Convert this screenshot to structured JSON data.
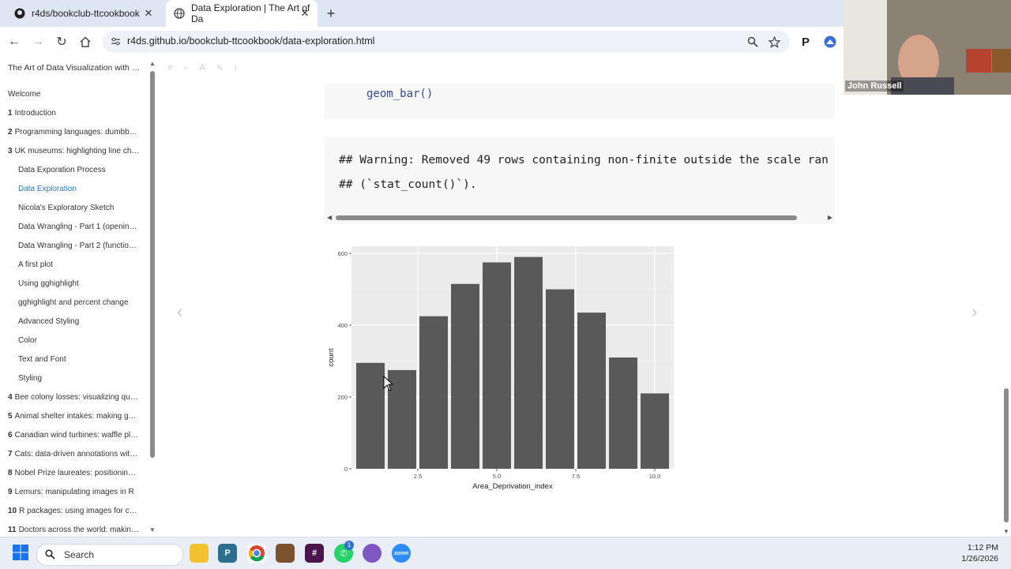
{
  "tabs": [
    {
      "title": "r4ds/bookclub-ttcookbook",
      "icon": "github-icon"
    },
    {
      "title": "Data Exploration | The Art of Da",
      "icon": "globe-icon"
    }
  ],
  "toolbar": {
    "url": "r4ds.github.io/bookclub-ttcookbook/data-exploration.html"
  },
  "sidebar": {
    "title": "The Art of Data Visualization with gg...",
    "items": [
      {
        "num": "",
        "label": "Welcome",
        "level": 1
      },
      {
        "num": "1",
        "label": "Introduction",
        "level": 1
      },
      {
        "num": "2",
        "label": "Programming languages: dumbbell...",
        "level": 1
      },
      {
        "num": "3",
        "label": "UK museums: highlighting line cha...",
        "level": 1
      },
      {
        "num": "",
        "label": "Data Exporation Process",
        "level": 2
      },
      {
        "num": "",
        "label": "Data Exploration",
        "level": 2,
        "active": true
      },
      {
        "num": "",
        "label": "Nicola's Exploratory Sketch",
        "level": 2
      },
      {
        "num": "",
        "label": "Data Wrangling - Part 1 (opening/...",
        "level": 2
      },
      {
        "num": "",
        "label": "Data Wrangling - Part 2 (function ...",
        "level": 2
      },
      {
        "num": "",
        "label": "A first plot",
        "level": 2
      },
      {
        "num": "",
        "label": "Using gghighlight",
        "level": 2
      },
      {
        "num": "",
        "label": "gghighlight and percent change",
        "level": 2
      },
      {
        "num": "",
        "label": "Advanced Styling",
        "level": 2
      },
      {
        "num": "",
        "label": "Color",
        "level": 2
      },
      {
        "num": "",
        "label": "Text and Font",
        "level": 2
      },
      {
        "num": "",
        "label": "Styling",
        "level": 2
      },
      {
        "num": "4",
        "label": "Bee colony losses: visualizing qua...",
        "level": 1
      },
      {
        "num": "5",
        "label": "Animal shelter intakes: making gau...",
        "level": 1
      },
      {
        "num": "6",
        "label": "Canadian wind turbines: waffle plot...",
        "level": 1
      },
      {
        "num": "7",
        "label": "Cats: data-driven annotations with ...",
        "level": 1
      },
      {
        "num": "8",
        "label": "Nobel Prize laureates: positioning t...",
        "level": 1
      },
      {
        "num": "9",
        "label": "Lemurs: manipulating images in R",
        "level": 1
      },
      {
        "num": "10",
        "label": "R packages: using images for cu...",
        "level": 1
      },
      {
        "num": "11",
        "label": "Doctors across the world: making...",
        "level": 1
      }
    ]
  },
  "content": {
    "code": "geom_bar()",
    "output_lines": [
      "## Warning: Removed 49 rows containing non-finite outside the scale ran",
      "## (`stat_count()`)."
    ]
  },
  "chart_data": {
    "type": "bar",
    "x": [
      1,
      2,
      3,
      4,
      5,
      6,
      7,
      8,
      9,
      10
    ],
    "values": [
      295,
      275,
      425,
      515,
      575,
      590,
      500,
      435,
      310,
      210
    ],
    "xticks": [
      "2.5",
      "5.0",
      "7.5",
      "10.0"
    ],
    "xtick_values": [
      2.5,
      5.0,
      7.5,
      10.0
    ],
    "yticks": [
      "0",
      "200",
      "400",
      "600"
    ],
    "ytick_values": [
      0,
      200,
      400,
      600
    ],
    "xlabel": "Area_Deprivation_index",
    "ylabel": "count",
    "xlim": [
      0.4,
      10.6
    ],
    "ylim": [
      0,
      620
    ],
    "grid": true,
    "bar_color": "#595959",
    "panel_color": "#ebebeb"
  },
  "video": {
    "name": "John Russell"
  },
  "taskbar": {
    "search": "Search",
    "time": "1:12 PM",
    "date": "1/26/2026",
    "badge": "1"
  },
  "colors": {
    "accent": "#2a7ac7",
    "tabbar": "#dfe6f3"
  }
}
